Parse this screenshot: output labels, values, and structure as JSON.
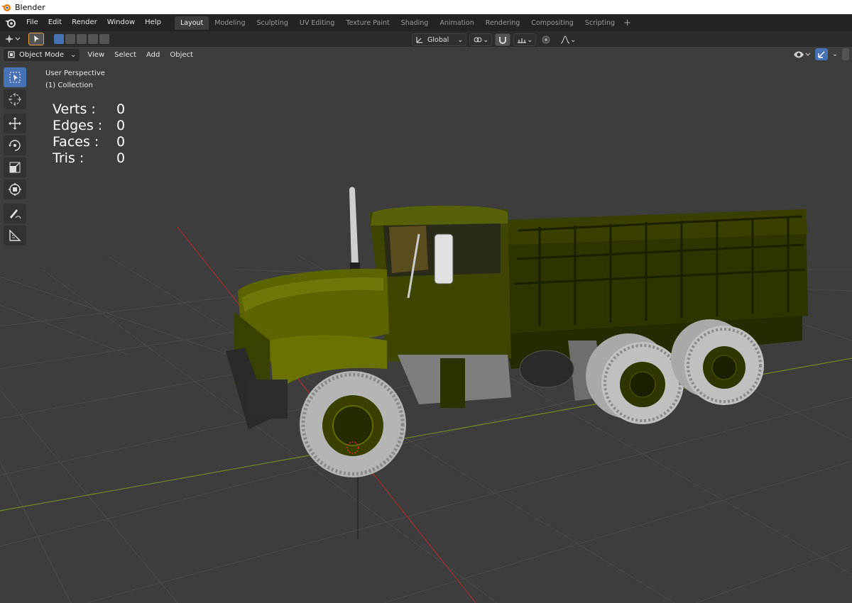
{
  "window": {
    "title": "Blender"
  },
  "menu": {
    "items": [
      "File",
      "Edit",
      "Render",
      "Window",
      "Help"
    ]
  },
  "workspaces": {
    "active": "Layout",
    "tabs": [
      "Layout",
      "Modeling",
      "Sculpting",
      "UV Editing",
      "Texture Paint",
      "Shading",
      "Animation",
      "Rendering",
      "Compositing",
      "Scripting"
    ],
    "add_symbol": "+"
  },
  "tool_settings": {
    "transform_orientation": "Global"
  },
  "header": {
    "mode": "Object Mode",
    "menus": [
      "View",
      "Select",
      "Add",
      "Object"
    ]
  },
  "viewport": {
    "perspective": "User Perspective",
    "collection": "(1) Collection",
    "stats": [
      {
        "label": "Verts :",
        "value": "0"
      },
      {
        "label": "Edges :",
        "value": "0"
      },
      {
        "label": "Faces :",
        "value": "0"
      },
      {
        "label": "Tris :",
        "value": "0"
      }
    ]
  },
  "left_tools": [
    {
      "name": "select-box-tool",
      "icon": "select-box-icon",
      "active": true
    },
    {
      "name": "cursor-tool",
      "icon": "cursor-icon",
      "active": false
    },
    {
      "name": "move-tool",
      "icon": "move-icon",
      "active": false
    },
    {
      "name": "rotate-tool",
      "icon": "rotate-icon",
      "active": false
    },
    {
      "name": "scale-tool",
      "icon": "scale-icon",
      "active": false
    },
    {
      "name": "transform-tool",
      "icon": "transform-icon",
      "active": false
    },
    {
      "name": "annotate-tool",
      "icon": "annotate-icon",
      "active": false
    },
    {
      "name": "measure-tool",
      "icon": "measure-icon",
      "active": false
    }
  ],
  "colors": {
    "accent": "#4772b3",
    "background": "#3d3d3d",
    "truck_body": "#4f5500",
    "x_axis": "#a03030",
    "y_axis": "#6e8a2a"
  }
}
